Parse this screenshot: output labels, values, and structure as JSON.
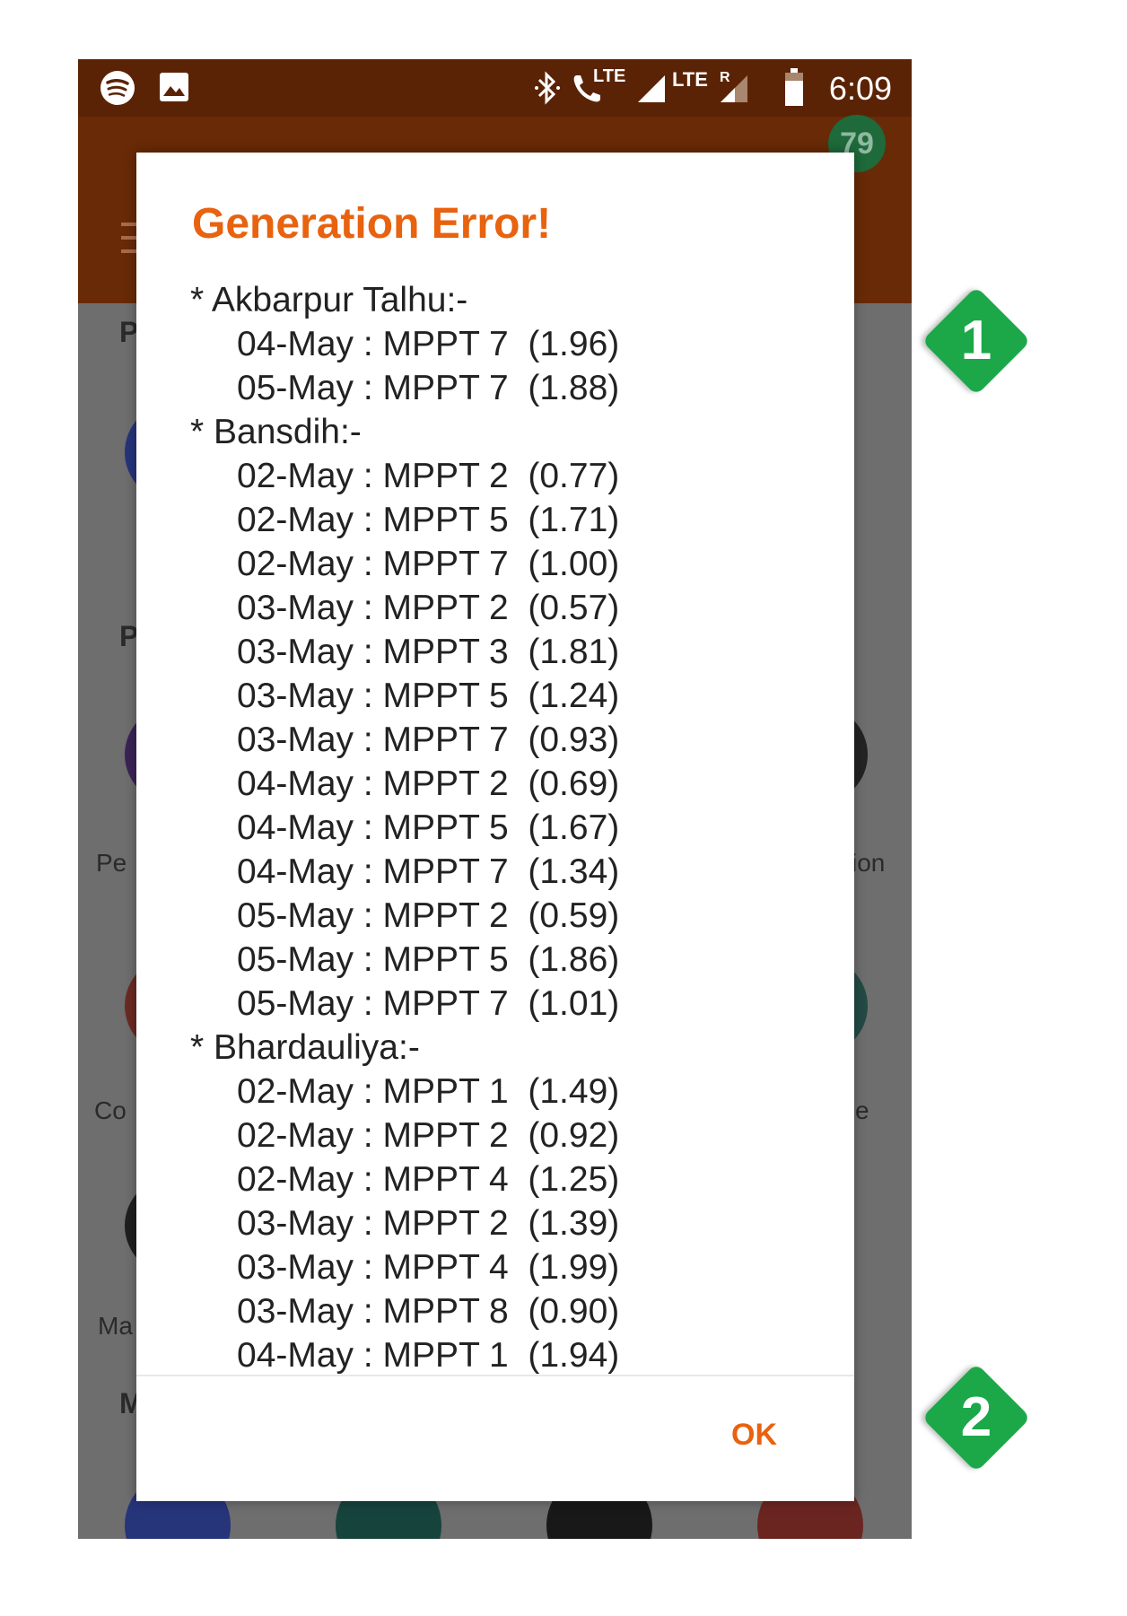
{
  "status_bar": {
    "time": "6:09",
    "lte_label": "LTE",
    "lte_label_2": "LTE",
    "roaming_label": "R",
    "notification_badge": "79"
  },
  "background": {
    "labels": [
      "P",
      "P",
      "Pe",
      "ion",
      "Co",
      "e",
      "Ma",
      "M"
    ]
  },
  "dialog": {
    "title": "Generation Error!",
    "sites": [
      {
        "header": "* Akbarpur Talhu:-",
        "entries": [
          "04-May : MPPT 7  (1.96)",
          "05-May : MPPT 7  (1.88)"
        ]
      },
      {
        "header": "* Bansdih:-",
        "entries": [
          "02-May : MPPT 2  (0.77)",
          "02-May : MPPT 5  (1.71)",
          "02-May : MPPT 7  (1.00)",
          "03-May : MPPT 2  (0.57)",
          "03-May : MPPT 3  (1.81)",
          "03-May : MPPT 5  (1.24)",
          "03-May : MPPT 7  (0.93)",
          "04-May : MPPT 2  (0.69)",
          "04-May : MPPT 5  (1.67)",
          "04-May : MPPT 7  (1.34)",
          "05-May : MPPT 2  (0.59)",
          "05-May : MPPT 5  (1.86)",
          "05-May : MPPT 7  (1.01)"
        ]
      },
      {
        "header": "* Bhardauliya:-",
        "entries": [
          "02-May : MPPT 1  (1.49)",
          "02-May : MPPT 2  (0.92)",
          "02-May : MPPT 4  (1.25)",
          "03-May : MPPT 2  (1.39)",
          "03-May : MPPT 4  (1.99)",
          "03-May : MPPT 8  (0.90)",
          "04-May : MPPT 1  (1.94)"
        ]
      }
    ],
    "ok_label": "OK"
  },
  "markers": [
    "1",
    "2"
  ],
  "colors": {
    "accent": "#e8620f",
    "app_bar": "#682a07",
    "marker_green": "#1fa84a"
  }
}
